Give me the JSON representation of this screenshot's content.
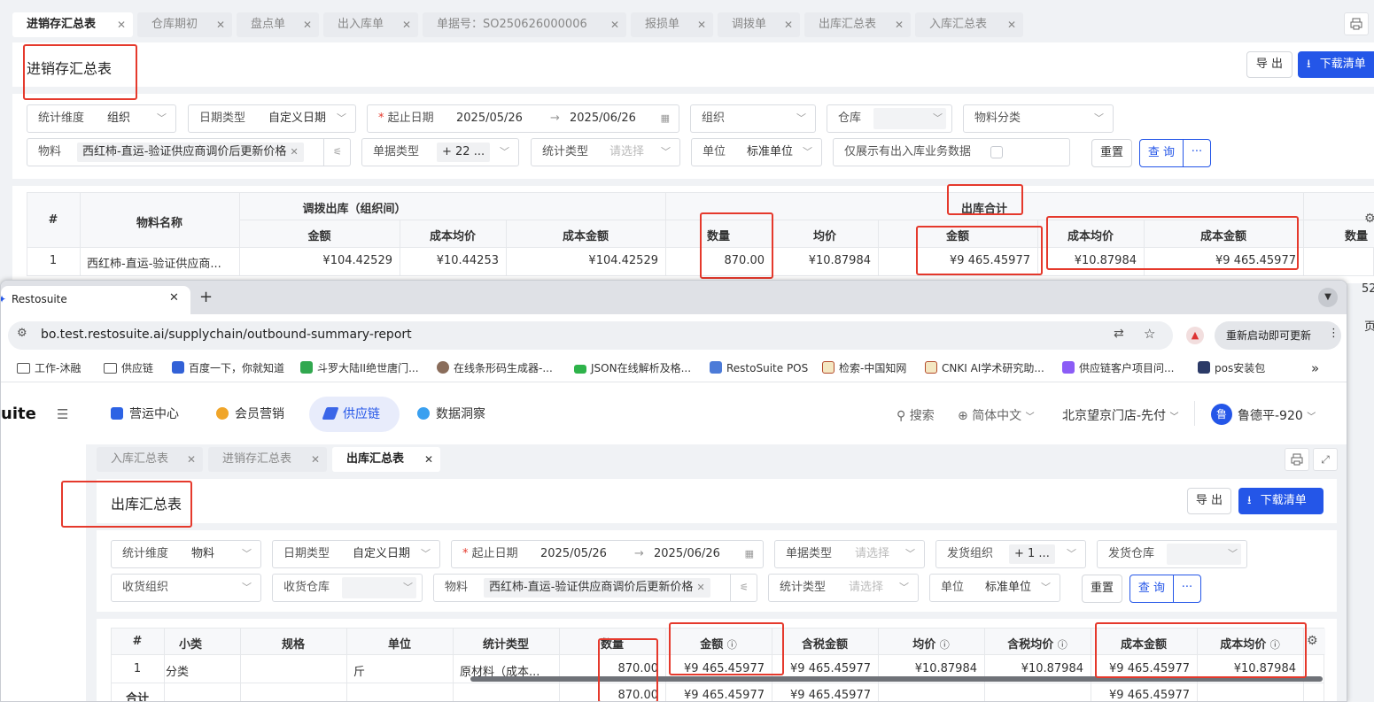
{
  "back": {
    "tabs": [
      {
        "label": "进销存汇总表",
        "active": true
      },
      {
        "label": "仓库期初"
      },
      {
        "label": "盘点单"
      },
      {
        "label": "出入库单"
      },
      {
        "label": "单据号：SO250626000006"
      },
      {
        "label": "报损单"
      },
      {
        "label": "调拨单"
      },
      {
        "label": "出库汇总表"
      },
      {
        "label": "入库汇总表"
      }
    ],
    "close_glyph": "✕",
    "page_title": "进销存汇总表",
    "export_label": "导 出",
    "download_label": "下载清单",
    "filters": {
      "stat_dim_label": "统计维度",
      "stat_dim_value": "组织",
      "date_type_label": "日期类型",
      "date_type_value": "自定义日期",
      "start_label": "起止日期",
      "start_date": "2025/05/26",
      "end_date": "2025/06/26",
      "org_placeholder": "组织",
      "warehouse_label": "仓库",
      "material_cat_placeholder": "物料分类",
      "material_label": "物料",
      "material_value": "西红柿-直运-验证供应商调价后更新价格",
      "doc_type_label": "单据类型",
      "doc_type_value": "+ 22 ...",
      "stat_type_label": "统计类型",
      "stat_type_placeholder": "请选择",
      "unit_label": "单位",
      "unit_value": "标准单位",
      "only_show_label": "仅展示有出入库业务数据",
      "reset_label": "重置",
      "query_label": "查 询",
      "more_label": "···"
    },
    "table": {
      "hash": "#",
      "name_header": "物料名称",
      "group1": "调拨出库（组织间）",
      "group2": "出库合计",
      "cols": [
        "金额",
        "成本均价",
        "成本金额",
        "数量",
        "均价",
        "金额",
        "成本均价",
        "成本金额",
        "数量"
      ],
      "row": [
        "1",
        "西红柿-直运-验证供应商...",
        "¥104.42529",
        "¥10.44253",
        "¥104.42529",
        "870.00",
        "¥10.87984",
        "¥9 465.45977",
        "¥10.87984",
        "¥9 465.45977"
      ],
      "peek_value": "52",
      "peek_page": "页"
    }
  },
  "browser": {
    "tab_title": "Restosuite",
    "new_tab": "+",
    "url": "bo.test.restosuite.ai/supplychain/outbound-summary-report",
    "update_label": "重新启动即可更新",
    "bookmarks": [
      "工作-沐融",
      "供应链",
      "百度一下，你就知道",
      "斗罗大陆II绝世唐门...",
      "在线条形码生成器-...",
      "JSON在线解析及格...",
      "RestoSuite POS",
      "检索-中国知网",
      "CNKI AI学术研究助...",
      "供应链客户项目问...",
      "pos安装包"
    ],
    "more_bookmarks": "»"
  },
  "app": {
    "logo": "uite",
    "nav": [
      "营运中心",
      "会员营销",
      "供应链",
      "数据洞察"
    ],
    "search": "搜索",
    "language": "简体中文",
    "store": "北京望京门店-先付",
    "avatar": "鲁",
    "user": "鲁德平-920",
    "tabs": [
      {
        "label": "入库汇总表"
      },
      {
        "label": "进销存汇总表"
      },
      {
        "label": "出库汇总表",
        "active": true
      }
    ],
    "page_title": "出库汇总表",
    "export_label": "导 出",
    "download_label": "下载清单",
    "filters": {
      "stat_dim_label": "统计维度",
      "stat_dim_value": "物料",
      "date_type_label": "日期类型",
      "date_type_value": "自定义日期",
      "start_label": "起止日期",
      "start_date": "2025/05/26",
      "end_date": "2025/06/26",
      "doc_type_label": "单据类型",
      "doc_type_placeholder": "请选择",
      "ship_org_label": "发货组织",
      "ship_org_value": "+ 1 ...",
      "ship_wh_label": "发货仓库",
      "recv_org_placeholder": "收货组织",
      "recv_wh_label": "收货仓库",
      "material_label": "物料",
      "material_value": "西红柿-直运-验证供应商调价后更新价格",
      "stat_type_label": "统计类型",
      "stat_type_placeholder": "请选择",
      "unit_label": "单位",
      "unit_value": "标准单位",
      "reset_label": "重置",
      "query_label": "查 询",
      "more_label": "···"
    },
    "table": {
      "headers": [
        "#",
        "小类",
        "规格",
        "单位",
        "统计类型",
        "数量",
        "金额",
        "含税金额",
        "均价",
        "含税均价",
        "成本金额",
        "成本均价"
      ],
      "row": [
        "1",
        "分类",
        "",
        "斤",
        "原材料（成本...",
        "870.00",
        "¥9 465.45977",
        "¥9 465.45977",
        "¥10.87984",
        "¥10.87984",
        "¥9 465.45977",
        "¥10.87984"
      ],
      "total_label": "合计",
      "total_qty": "870.00",
      "total_amount": "¥9 465.45977",
      "total_tax_amount": "¥9 465.45977",
      "total_cost_amount": "¥9 465.45977"
    }
  },
  "colors": {
    "primary": "#2456e8",
    "highlight": "#e5392c",
    "nav_active_bg": "#e8ecfb"
  }
}
